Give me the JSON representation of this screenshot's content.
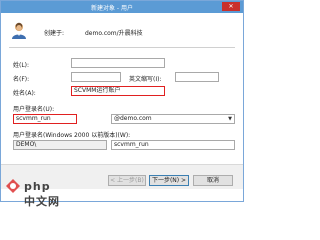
{
  "window": {
    "title": "新建对象 - 用户",
    "close_glyph": "✕"
  },
  "header": {
    "create_label": "创建于:",
    "path": "demo.com/升晨科技"
  },
  "form": {
    "last_name": {
      "label": "姓(L):",
      "value": ""
    },
    "first_name": {
      "label": "名(F):",
      "value": ""
    },
    "initials": {
      "label": "英文缩写(I):",
      "value": ""
    },
    "full_name": {
      "label": "姓名(A):",
      "value": "SCVMM运行账户"
    },
    "logon_name": {
      "label": "用户登录名(U):",
      "value": "scvmm_run",
      "domain": "@demo.com"
    },
    "pre2000": {
      "label": "用户登录名(Windows 2000 以前版本)(W):",
      "domain": "DEMO\\",
      "value": "scvmm_run"
    }
  },
  "footer": {
    "back": "< 上一步(B)",
    "next": "下一步(N) >",
    "cancel": "取消"
  },
  "watermark": {
    "text": "php 中文网"
  }
}
